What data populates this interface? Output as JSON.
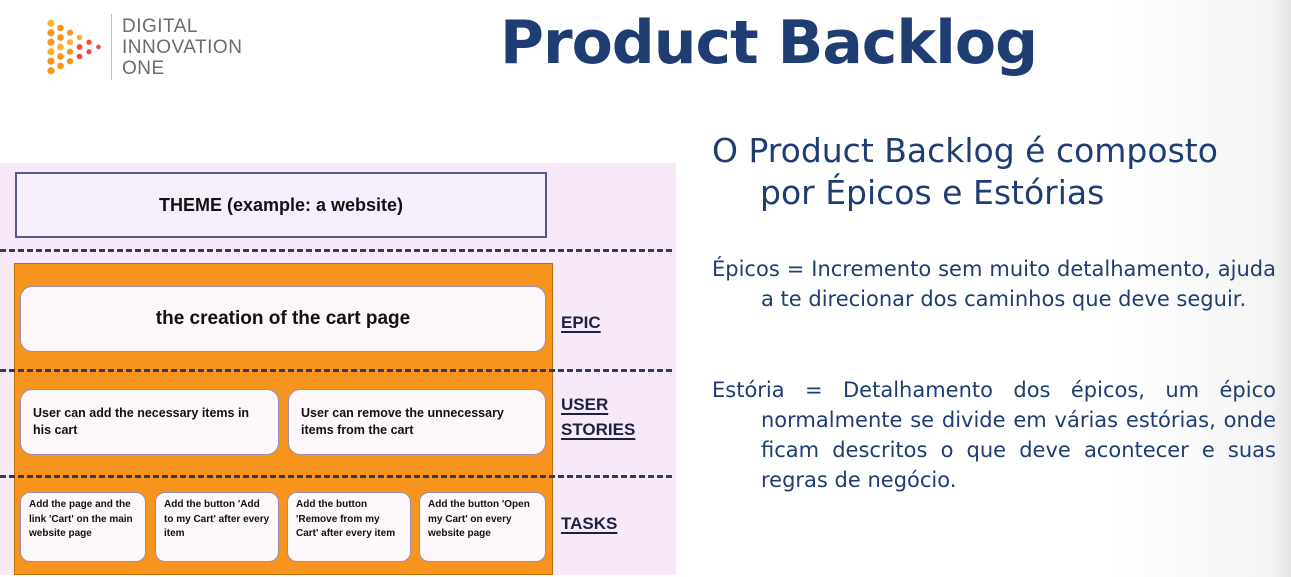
{
  "logo": {
    "line1": "DIGITAL",
    "line2": "INNOVATION",
    "line3": "ONE",
    "colors": {
      "orange": "#f7941d",
      "red": "#e8503a",
      "gray": "#6b6b6b"
    }
  },
  "title": "Product Backlog",
  "diagram": {
    "theme": "THEME (example: a website)",
    "epic": "the creation of the cart page",
    "stories": [
      "User can add the necessary items in his cart",
      "User can remove the unnecessary items from the cart"
    ],
    "tasks": [
      "Add the page and the link 'Cart' on the main website page",
      "Add the button 'Add to my Cart' after every item",
      "Add the button 'Remove from my Cart' after every item",
      "Add the button 'Open my Cart' on every website page"
    ],
    "labels": {
      "epic": "EPIC",
      "user_stories_line1": "USER",
      "user_stories_line2": "STORIES",
      "tasks": "TASKS"
    },
    "colors": {
      "orange": "#f7941d",
      "lavender": "#f7e9f7",
      "dash": "#333a5a"
    }
  },
  "content": {
    "heading": "O Product Backlog é composto por Épicos e Estórias",
    "epicos": "Épicos = Incremento sem muito detalhamento, ajuda a te direcionar dos caminhos que deve seguir.",
    "estoria": "Estória = Detalhamento dos épicos, um épico normalmente se divide em várias estórias, onde ficam descritos o que deve acontecer e suas regras de negócio.",
    "color": "#1f3d73"
  }
}
